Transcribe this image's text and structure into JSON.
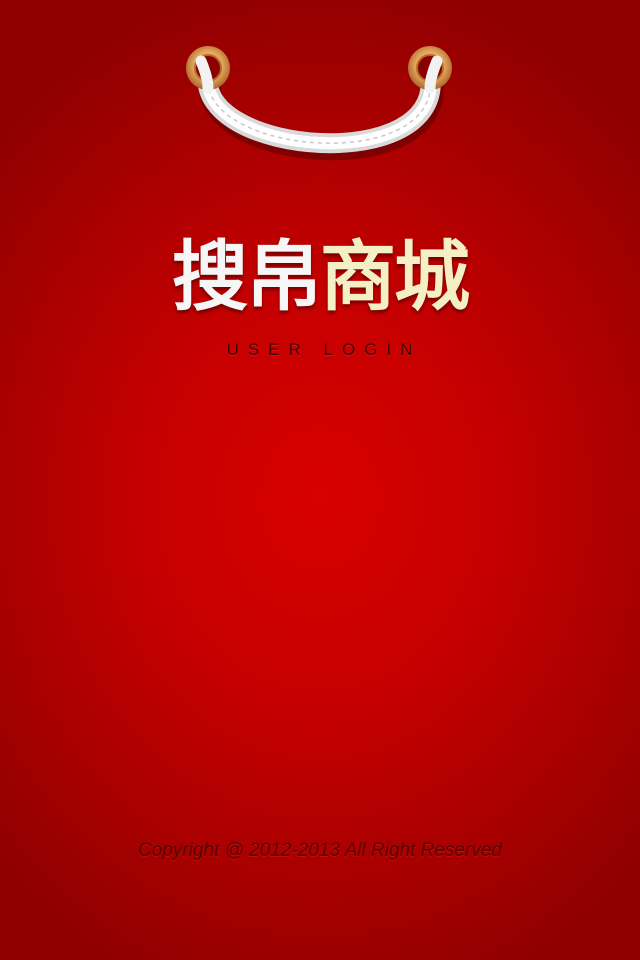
{
  "logo": {
    "part1": "搜帛",
    "part2": "商城"
  },
  "subtitle": "USER LOGIN",
  "copyright": "Copyright @ 2012-2013 All Right Reserved",
  "colors": {
    "background": "#c50000",
    "logo_part1": "#f6f6f6",
    "logo_part2": "#f4efc4",
    "subtitle": "#4a0000",
    "copyright": "#5a0000"
  },
  "icons": {
    "handle": "bag-handle-icon"
  }
}
